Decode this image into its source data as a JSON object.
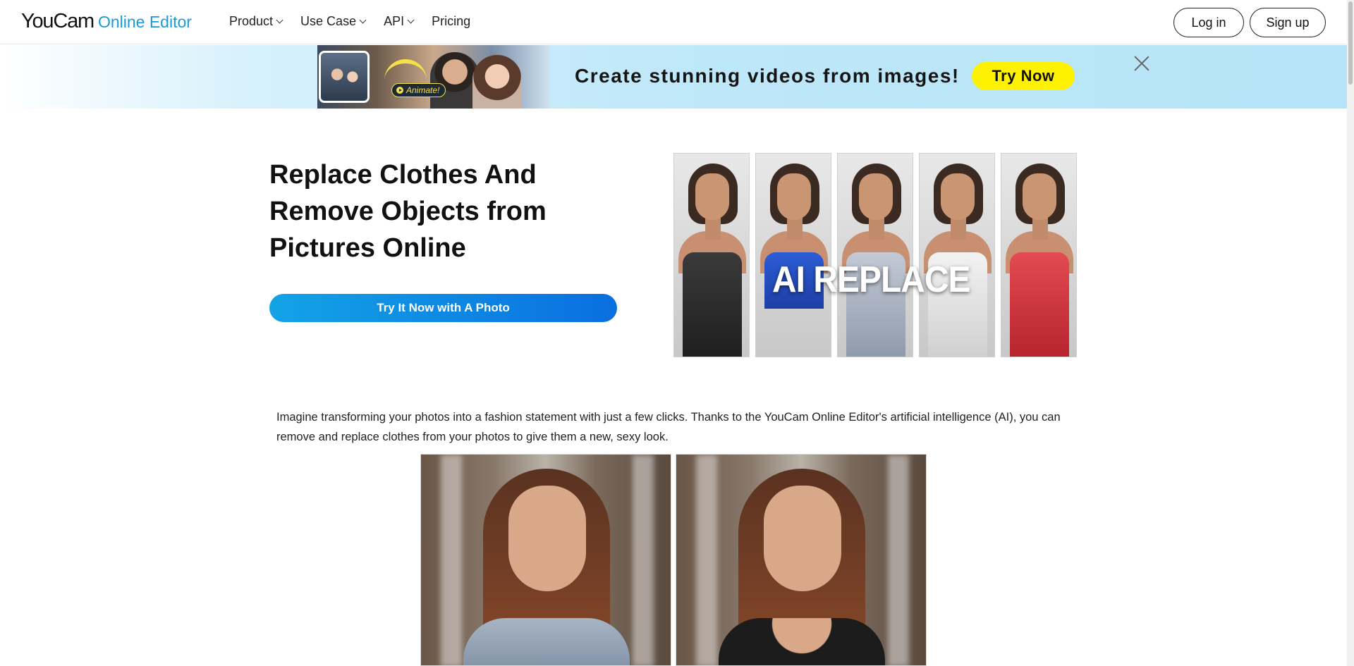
{
  "header": {
    "logo_main": "YouCam",
    "logo_sub": "Online Editor",
    "nav": [
      {
        "label": "Product"
      },
      {
        "label": "Use Case"
      },
      {
        "label": "API"
      },
      {
        "label": "Pricing"
      }
    ],
    "login_label": "Log in",
    "signup_label": "Sign up"
  },
  "banner": {
    "badge": "Animate!",
    "text": "Create stunning videos from images!",
    "cta": "Try Now"
  },
  "hero": {
    "title": "Replace Clothes And Remove Objects from Pictures Online",
    "cta": "Try It Now with A Photo",
    "gallery_overlay": "AI REPLACE"
  },
  "intro": "Imagine transforming your photos into a fashion statement with just a few clicks. Thanks to the YouCam Online Editor's artificial intelligence (AI), you can remove and replace clothes from your photos to give them a new, sexy look.",
  "colors": {
    "brand": "#1a9ad6",
    "cta_gradient_start": "#13a3e6",
    "cta_gradient_end": "#0a6fe0",
    "banner_cta": "#fff200"
  }
}
